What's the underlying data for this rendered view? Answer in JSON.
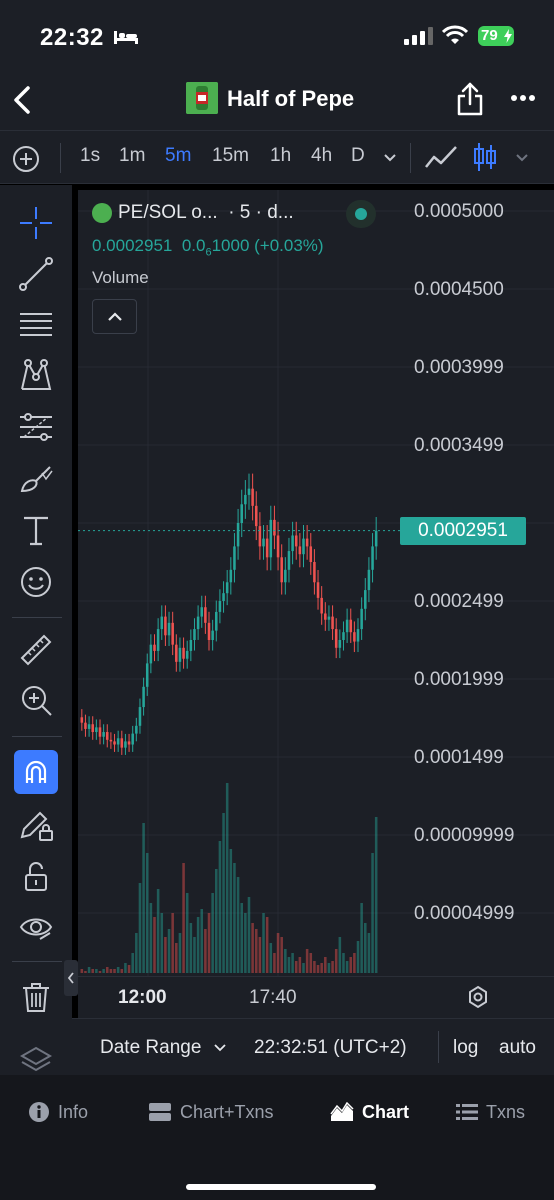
{
  "status_bar": {
    "time": "22:32",
    "battery": "79"
  },
  "header": {
    "title": "Half of Pepe"
  },
  "intervals": [
    "1s",
    "1m",
    "5m",
    "15m",
    "1h",
    "4h",
    "D"
  ],
  "active_interval": "5m",
  "legend": {
    "pair": "PE/SOL o...",
    "meta": "· 5 · d...",
    "price": "0.0002951",
    "change_prefix": "0.0",
    "change_sub": "6",
    "change_rest": "1000 (+0.03%)",
    "volume_label": "Volume"
  },
  "price_axis": [
    "0.0005000",
    "0.0004500",
    "0.0003999",
    "0.0003499",
    "0.0002499",
    "0.0001999",
    "0.0001499",
    "0.00009999",
    "0.00004999"
  ],
  "current_price_tag": "0.0002951",
  "time_axis": {
    "t1": "12:00",
    "t2": "17:40"
  },
  "controls": {
    "date_range": "Date Range",
    "clock": "22:32:51 (UTC+2)",
    "log": "log",
    "auto": "auto"
  },
  "tabs": [
    "Info",
    "Chart+Txns",
    "Chart",
    "Txns"
  ],
  "active_tab": "Chart",
  "colors": {
    "up": "#26a69a",
    "down": "#ef5350",
    "accent": "#3d7bff",
    "panel": "#1c1f26"
  },
  "chart_data": {
    "type": "candlestick",
    "interval": "5m",
    "close_prices": [
      0.000172,
      0.000168,
      0.000171,
      0.000166,
      0.000169,
      0.000163,
      0.000166,
      0.000161,
      0.00016,
      0.000158,
      0.000162,
      0.000156,
      0.00016,
      0.000158,
      0.000165,
      0.00017,
      0.000182,
      0.000195,
      0.00021,
      0.000222,
      0.000218,
      0.000232,
      0.00024,
      0.000228,
      0.000236,
      0.000222,
      0.000211,
      0.00022,
      0.000213,
      0.000218,
      0.000225,
      0.000232,
      0.00024,
      0.000246,
      0.000236,
      0.000225,
      0.000231,
      0.000243,
      0.00025,
      0.000255,
      0.000262,
      0.00027,
      0.000285,
      0.0003,
      0.000312,
      0.000318,
      0.000322,
      0.000311,
      0.000298,
      0.000285,
      0.00029,
      0.000278,
      0.000302,
      0.000292,
      0.000278,
      0.000262,
      0.00027,
      0.000282,
      0.000292,
      0.000285,
      0.00028,
      0.00029,
      0.000285,
      0.000275,
      0.000262,
      0.000252,
      0.000242,
      0.000238,
      0.00024,
      0.000232,
      0.00022,
      0.000225,
      0.00023,
      0.000238,
      0.00023,
      0.000224,
      0.000232,
      0.000245,
      0.000257,
      0.00027,
      0.000285,
      0.000295
    ],
    "volume_relative": [
      0.02,
      0.01,
      0.03,
      0.02,
      0.02,
      0.01,
      0.02,
      0.03,
      0.02,
      0.02,
      0.03,
      0.02,
      0.05,
      0.04,
      0.1,
      0.2,
      0.45,
      0.75,
      0.6,
      0.35,
      0.28,
      0.42,
      0.3,
      0.18,
      0.22,
      0.3,
      0.15,
      0.2,
      0.55,
      0.4,
      0.25,
      0.18,
      0.28,
      0.32,
      0.22,
      0.3,
      0.4,
      0.52,
      0.66,
      0.8,
      0.95,
      0.62,
      0.55,
      0.48,
      0.35,
      0.3,
      0.38,
      0.25,
      0.22,
      0.18,
      0.3,
      0.28,
      0.15,
      0.1,
      0.2,
      0.18,
      0.12,
      0.08,
      0.1,
      0.06,
      0.08,
      0.05,
      0.12,
      0.1,
      0.06,
      0.04,
      0.05,
      0.08,
      0.05,
      0.06,
      0.12,
      0.18,
      0.1,
      0.06,
      0.08,
      0.1,
      0.16,
      0.35,
      0.25,
      0.2,
      0.6,
      0.78
    ],
    "ylim": [
      0,
      0.0005
    ],
    "current_price": 0.0002951
  }
}
